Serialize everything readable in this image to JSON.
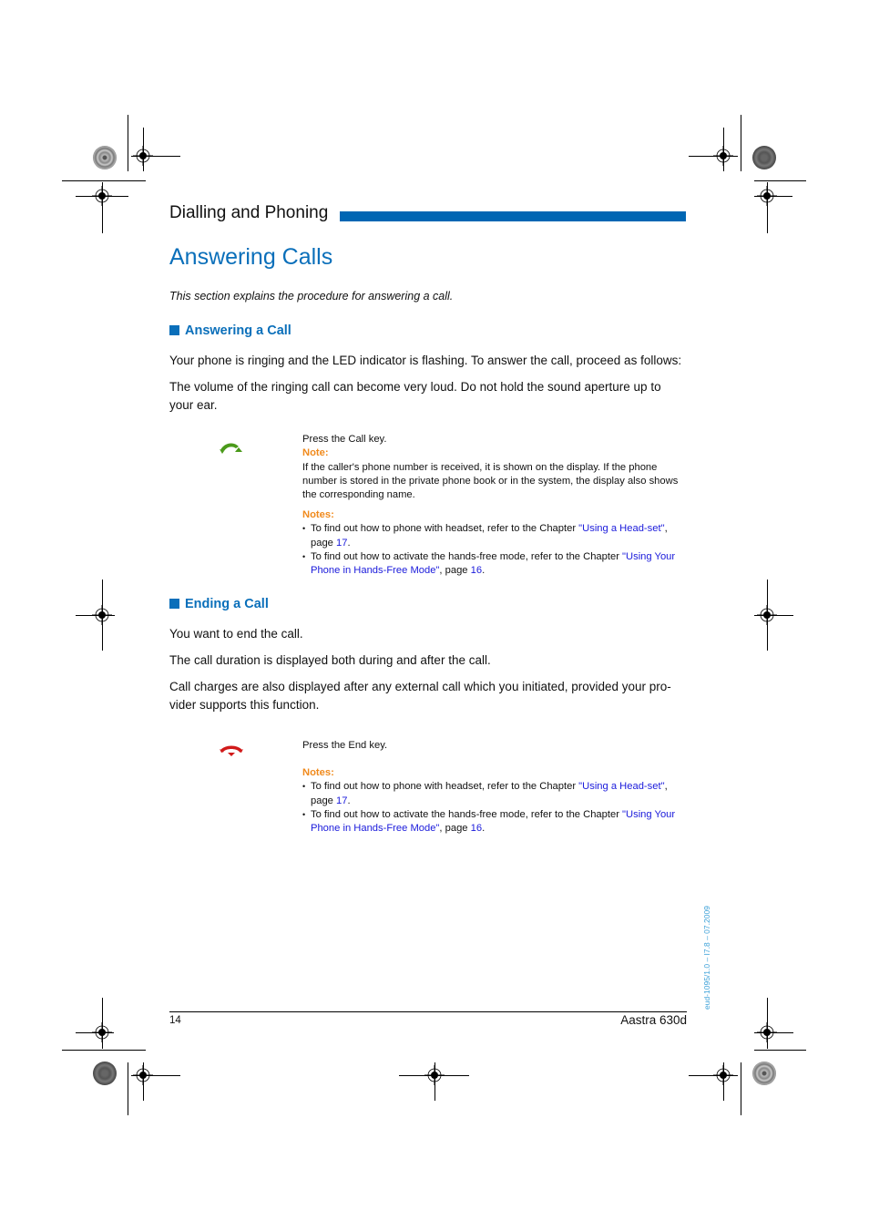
{
  "header": {
    "chapter_title": "Dialling and Phoning",
    "accent_color": "#0066b3"
  },
  "page_title": "Answering Calls",
  "intro": "This section explains the procedure for answering a call.",
  "sections": [
    {
      "heading": "Answering a Call",
      "paragraphs": [
        "Your phone is ringing and the LED indicator is flashing. To answer the call, proceed as follows:",
        "The volume of the ringing call can become very loud. Do not hold the sound aperture up to your ear."
      ],
      "step": {
        "icon": "call-key-icon",
        "icon_color": "#4a9a1a",
        "instruction": "Press the Call key.",
        "note_label": "Note:",
        "note_text": "If the caller's phone number is received, it is shown on the display. If the phone number is stored in the private phone book or in the system, the display also shows the corresponding name."
      },
      "notes_label": "Notes:",
      "notes": [
        {
          "before": "To find out how to phone with headset, refer to the Chapter ",
          "link": "\"Using a Head-set\"",
          "mid": ", page ",
          "page": "17",
          "after": "."
        },
        {
          "before": "To find out how to activate the hands-free mode, refer to the Chapter ",
          "link": "\"Using Your Phone in Hands-Free Mode\"",
          "mid": ", page ",
          "page": "16",
          "after": "."
        }
      ]
    },
    {
      "heading": "Ending a Call",
      "paragraphs": [
        "You want to end the call.",
        "The call duration is displayed both during and after the call.",
        "Call charges are also displayed after any external call which you initiated, provided your pro-vider supports this function."
      ],
      "step": {
        "icon": "end-key-icon",
        "icon_color": "#d11a1a",
        "instruction": "Press the End key."
      },
      "notes_label": "Notes:",
      "notes": [
        {
          "before": "To find out how to phone with headset, refer to the Chapter ",
          "link": "\"Using a Head-set\"",
          "mid": ", page ",
          "page": "17",
          "after": "."
        },
        {
          "before": "To find out how to activate the hands-free mode, refer to the Chapter ",
          "link": "\"Using Your Phone in Hands-Free Mode\"",
          "mid": ", page ",
          "page": "16",
          "after": "."
        }
      ]
    }
  ],
  "footer": {
    "page_number": "14",
    "model": "Aastra 630d",
    "doc_id": "eud-1095/1.0 – I7.8 – 07.2009"
  }
}
